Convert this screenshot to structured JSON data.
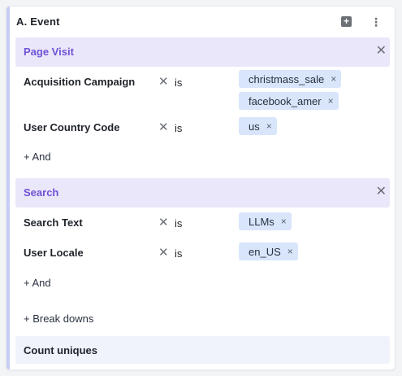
{
  "panel": {
    "title": "A.  Event",
    "add_icon": "plus-square-icon",
    "menu_icon": "kebab-icon"
  },
  "sections": [
    {
      "title": "Page Visit",
      "filters": [
        {
          "label": "Acquisition Campaign",
          "operator": "is",
          "values": [
            "christmass_sale",
            "facebook_amer"
          ]
        },
        {
          "label": "User Country Code",
          "operator": "is",
          "values": [
            "us"
          ]
        }
      ],
      "and_label": "+ And"
    },
    {
      "title": "Search",
      "filters": [
        {
          "label": "Search Text",
          "operator": "is",
          "values": [
            "LLMs"
          ]
        },
        {
          "label": "User Locale",
          "operator": "is",
          "values": [
            "en_US"
          ]
        }
      ],
      "and_label": "+ And"
    }
  ],
  "breakdowns_label": "+ Break downs",
  "count_label": "Count uniques",
  "glyphs": {
    "remove": "✕",
    "chip_remove": "×",
    "plus": "+",
    "kebab": "⋮"
  },
  "colors": {
    "section_bg": "#ebe7fb",
    "section_title": "#6f52d6",
    "chip_bg": "#d8e5fb",
    "accent_border": "#c7cef6"
  }
}
